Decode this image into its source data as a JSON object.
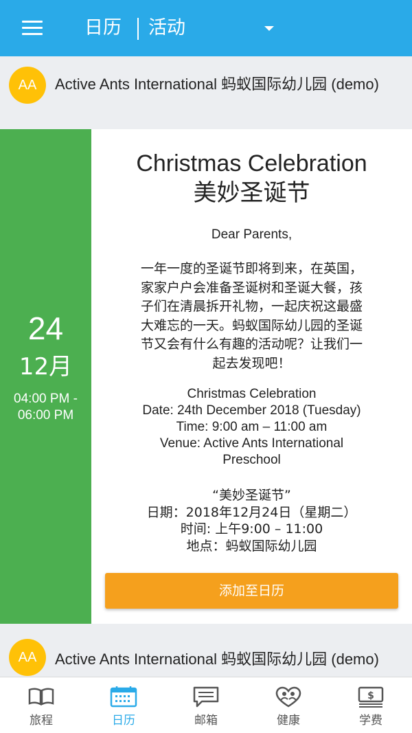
{
  "header": {
    "tab_calendar": "日历",
    "tab_activities": "活动"
  },
  "school": {
    "avatar_initials": "AA",
    "name": "Active Ants International 蚂蚁国际幼儿园 (demo)"
  },
  "event": {
    "day": "24",
    "month": "12月",
    "time_range": "04:00 PM - 06:00 PM",
    "title_en": "Christmas Celebration",
    "title_cn": "美妙圣诞节",
    "greeting": "Dear Parents,",
    "intro_lines": [
      "一年一度的圣诞节即将到来，在英国，",
      "家家户户会准备圣诞树和圣诞大餐，孩",
      "子们在清晨拆开礼物，一起庆祝这最盛",
      "大难忘的一天。蚂蚁国际幼儿园的圣诞",
      "节又会有什么有趣的活动呢？让我们一",
      "起去发现吧！"
    ],
    "details_en": [
      "Christmas Celebration",
      "Date: 24th December 2018 (Tuesday)",
      "Time: 9:00 am – 11:00 am",
      "Venue: Active Ants International",
      "Preschool"
    ],
    "details_cn": [
      "“美妙圣诞节”",
      "日期：2018年12月24日（星期二）",
      "时间: 上午9:00 – 11:00",
      "地点：蚂蚁国际幼儿园"
    ],
    "add_button": "添加至日历"
  },
  "next_school": {
    "avatar_initials": "AA",
    "name": "Active Ants International 蚂蚁国际幼儿园 (demo)"
  },
  "nav": [
    {
      "label": "旅程",
      "icon": "book-icon"
    },
    {
      "label": "日历",
      "icon": "calendar-icon"
    },
    {
      "label": "邮箱",
      "icon": "message-icon"
    },
    {
      "label": "健康",
      "icon": "heart-people-icon"
    },
    {
      "label": "学费",
      "icon": "money-icon"
    }
  ],
  "colors": {
    "topbar": "#2aaae8",
    "date_column": "#4caf50",
    "avatar": "#ffc107",
    "button": "#f5a01d",
    "nav_active": "#2aaae8"
  }
}
